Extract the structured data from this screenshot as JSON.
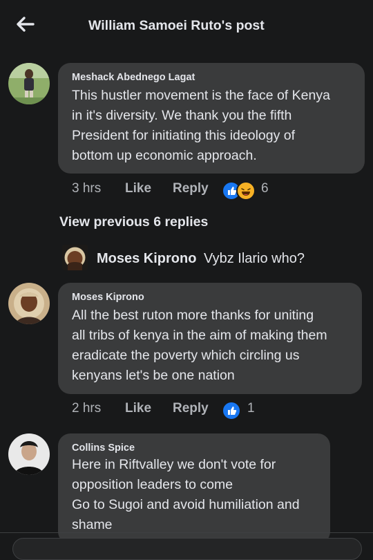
{
  "header": {
    "title": "William Samoei Ruto's post",
    "back_icon": "arrow-left-icon"
  },
  "comments": [
    {
      "author": "Meshack Abednego Lagat",
      "lines": [
        "This hustler movement is the face of Kenya",
        "in it's diversity. We thank you the fifth",
        "President  for initiating this ideology of",
        "bottom up economic approach."
      ],
      "time": "3 hrs",
      "like_label": "Like",
      "reply_label": "Reply",
      "reactions": [
        "like",
        "haha"
      ],
      "reaction_count": "6"
    },
    {
      "author": "Moses Kiprono",
      "lines": [
        "All the best ruton more thanks for uniting",
        "all tribs of kenya in the aim of making them",
        "eradicate the poverty which circling us",
        "kenyans let's be one nation"
      ],
      "time": "2 hrs",
      "like_label": "Like",
      "reply_label": "Reply",
      "reactions": [
        "like"
      ],
      "reaction_count": "1"
    },
    {
      "author": "Collins Spice",
      "lines": [
        "Here in Riftvalley we don't vote for",
        "opposition leaders to come",
        "Go to Sugoi and avoid humiliation and",
        "shame"
      ]
    }
  ],
  "view_previous": "View previous 6 replies",
  "reply_preview": {
    "author": "Moses Kiprono",
    "text": "Vybz Ilario who?"
  },
  "colors": {
    "background": "#18191a",
    "bubble": "#3a3b3c",
    "text": "#e4e6eb",
    "muted": "#b0b3b8",
    "like_blue": "#1877f2",
    "haha_yellow": "#f7b125"
  }
}
